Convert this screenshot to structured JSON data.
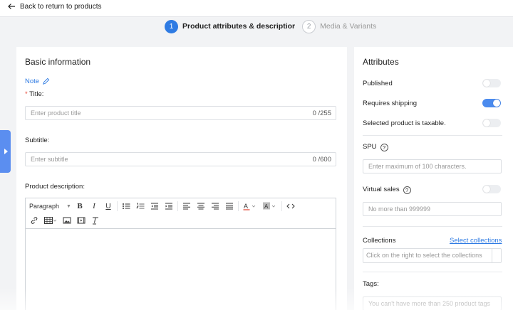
{
  "header": {
    "back_label": "Back to return to products"
  },
  "steps": [
    {
      "number": "1",
      "label": "Product attributes & descriptior"
    },
    {
      "number": "2",
      "label": "Media & Variants"
    }
  ],
  "basic": {
    "title": "Basic information",
    "note": "Note",
    "title_label": "Title",
    "title_required": "*",
    "title_placeholder": "Enter product title",
    "title_count": "0 /255",
    "subtitle_label": "Subtitle",
    "subtitle_placeholder": "Enter subtitle",
    "subtitle_count": "0 /600",
    "description_label": "Product description",
    "colon": ":"
  },
  "editor": {
    "paragraph": "Paragraph",
    "row1_icons": [
      "bold-icon",
      "italic-icon",
      "underline-icon",
      "bullet-list-icon",
      "numbered-list-icon",
      "outdent-icon",
      "indent-icon",
      "align-left-icon",
      "align-center-icon",
      "align-right-icon",
      "align-justify-icon",
      "font-color-icon",
      "background-color-icon",
      "code-icon"
    ],
    "row2_icons": [
      "link-icon",
      "table-icon",
      "image-icon",
      "video-icon",
      "clear-format-icon"
    ]
  },
  "attributes": {
    "title": "Attributes",
    "published": "Published",
    "published_on": false,
    "requires_shipping": "Requires shipping",
    "requires_shipping_on": true,
    "taxable": "Selected product is taxable.",
    "taxable_on": false,
    "spu": "SPU",
    "spu_placeholder": "Enter maximum of 100 characters.",
    "virtual_sales": "Virtual sales",
    "virtual_sales_on": false,
    "virtual_placeholder": "No more than 999999",
    "collections": "Collections",
    "select_collections": "Select collections",
    "collections_placeholder": "Click on the right to select the collections",
    "tags": "Tags",
    "tags_placeholder": "You can't have more than 250 product tags"
  },
  "colors": {
    "accent": "#2f7be3",
    "side_tab": "#5b8ef0",
    "required": "#e74c3c"
  }
}
